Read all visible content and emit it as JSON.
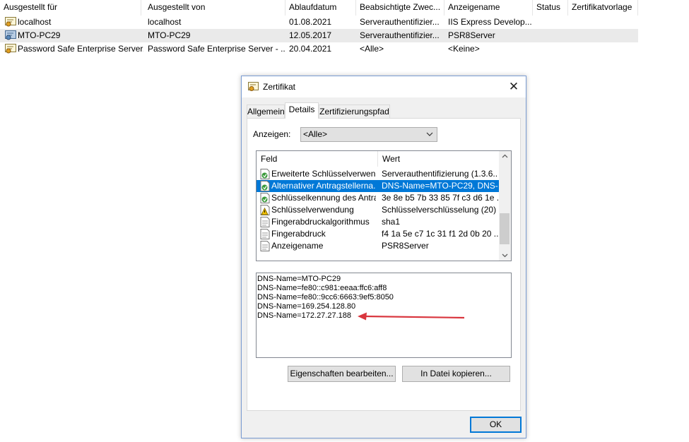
{
  "list": {
    "columns": [
      "Ausgestellt für",
      "Ausgestellt von",
      "Ablaufdatum",
      "Beabsichtigte Zwec...",
      "Anzeigename",
      "Status",
      "Zertifikatvorlage"
    ],
    "rows": [
      {
        "issued_to": "localhost",
        "issued_by": "localhost",
        "expires": "01.08.2021",
        "purpose": "Serverauthentifizier...",
        "friendly_name": "IIS Express Develop..."
      },
      {
        "issued_to": "MTO-PC29",
        "issued_by": "MTO-PC29",
        "expires": "12.05.2017",
        "purpose": "Serverauthentifizier...",
        "friendly_name": "PSR8Server"
      },
      {
        "issued_to": "Password Safe Enterprise Server...",
        "issued_by": "Password Safe Enterprise Server - ...",
        "expires": "20.04.2021",
        "purpose": "<Alle>",
        "friendly_name": "<Keine>"
      }
    ]
  },
  "dialog": {
    "title": "Zertifikat",
    "tabs": [
      "Allgemein",
      "Details",
      "Zertifizierungspfad"
    ],
    "show_label": "Anzeigen:",
    "show_value": "<Alle>",
    "fields_header": {
      "field": "Feld",
      "value": "Wert"
    },
    "fields": [
      {
        "field": "Erweiterte Schlüsselverwen...",
        "value": "Serverauthentifizierung (1.3.6....",
        "icon": "extension-icon"
      },
      {
        "field": "Alternativer Antragstellerna...",
        "value": "DNS-Name=MTO-PC29, DNS-...",
        "icon": "extension-icon"
      },
      {
        "field": "Schlüsselkennung des Antra...",
        "value": "3e 8e b5 7b 33 85 7f c3 d6 1e ...",
        "icon": "extension-icon"
      },
      {
        "field": "Schlüsselverwendung",
        "value": "Schlüsselverschlüsselung (20)",
        "icon": "warning-extension-icon"
      },
      {
        "field": "Fingerabdruckalgorithmus",
        "value": "sha1",
        "icon": "property-icon"
      },
      {
        "field": "Fingerabdruck",
        "value": "f4 1a 5e c7 1c 31 f1 2d 0b 20 ...",
        "icon": "property-icon"
      },
      {
        "field": "Anzeigename",
        "value": "PSR8Server",
        "icon": "property-icon"
      }
    ],
    "value_lines": [
      "DNS-Name=MTO-PC29",
      "DNS-Name=fe80::c981:eeaa:ffc6:aff8",
      "DNS-Name=fe80::9cc6:6663:9ef5:8050",
      "DNS-Name=169.254.128.80",
      "DNS-Name=172.27.27.188"
    ],
    "edit_button": "Eigenschaften bearbeiten...",
    "copy_button": "In Datei kopieren...",
    "ok_button": "OK",
    "accent_color": "#0078d7",
    "annotation_arrow_color": "#d9363e"
  }
}
